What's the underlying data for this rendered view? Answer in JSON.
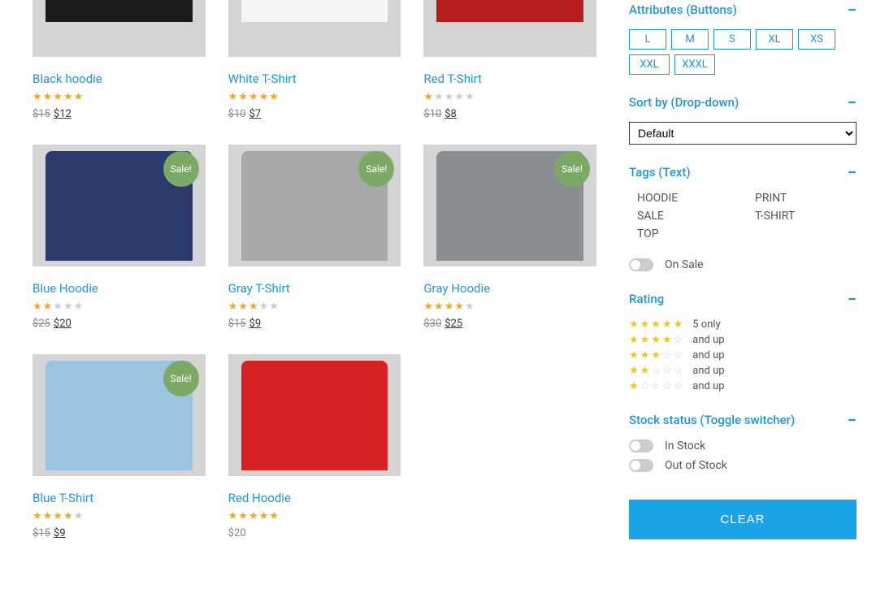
{
  "products": [
    {
      "title": "Black hoodie",
      "rating": 5,
      "old_price": "$15",
      "new_price": "$12",
      "sale": false,
      "color": "#1a1a1a",
      "cut": true
    },
    {
      "title": "White T-Shirt",
      "rating": 5,
      "old_price": "$10",
      "new_price": "$7",
      "sale": false,
      "color": "#f5f5f5",
      "cut": true
    },
    {
      "title": "Red T-Shirt",
      "rating": 1,
      "old_price": "$10",
      "new_price": "$8",
      "sale": false,
      "color": "#b51c1c",
      "cut": true
    },
    {
      "title": "Blue Hoodie",
      "rating": 2,
      "old_price": "$25",
      "new_price": "$20",
      "sale": true,
      "color": "#2b3a6b",
      "cut": false
    },
    {
      "title": "Gray T-Shirt",
      "rating": 3,
      "old_price": "$15",
      "new_price": "$9",
      "sale": true,
      "color": "#a8a8a8",
      "cut": false
    },
    {
      "title": "Gray Hoodie",
      "rating": 4,
      "old_price": "$30",
      "new_price": "$25",
      "sale": true,
      "color": "#8a8d91",
      "cut": false
    },
    {
      "title": "Blue T-Shirt",
      "rating": 4,
      "old_price": "$15",
      "new_price": "$9",
      "sale": true,
      "color": "#9cc3e0",
      "cut": false
    },
    {
      "title": "Red Hoodie",
      "rating": 5,
      "old_price": null,
      "new_price": "$20",
      "sale": false,
      "color": "#d62222",
      "cut": false
    }
  ],
  "sale_label": "Sale!",
  "sidebar": {
    "attributes": {
      "title": "Attributes (Buttons)",
      "options": [
        "L",
        "M",
        "S",
        "XL",
        "XS",
        "XXL",
        "XXXL"
      ]
    },
    "sort": {
      "title": "Sort by (Drop-down)",
      "selected": "Default"
    },
    "tags": {
      "title": "Tags (Text)",
      "items": [
        "HOODIE",
        "PRINT",
        "SALE",
        "T-SHIRT",
        "TOP"
      ]
    },
    "on_sale_label": "On Sale",
    "rating": {
      "title": "Rating",
      "rows": [
        {
          "stars": 5,
          "label": "5 only"
        },
        {
          "stars": 4,
          "label": "and up"
        },
        {
          "stars": 3,
          "label": "and up"
        },
        {
          "stars": 2,
          "label": "and up"
        },
        {
          "stars": 1,
          "label": "and up"
        }
      ]
    },
    "stock": {
      "title": "Stock status (Toggle switcher)",
      "in_stock": "In Stock",
      "out_of_stock": "Out of Stock"
    },
    "clear": "CLEAR"
  }
}
